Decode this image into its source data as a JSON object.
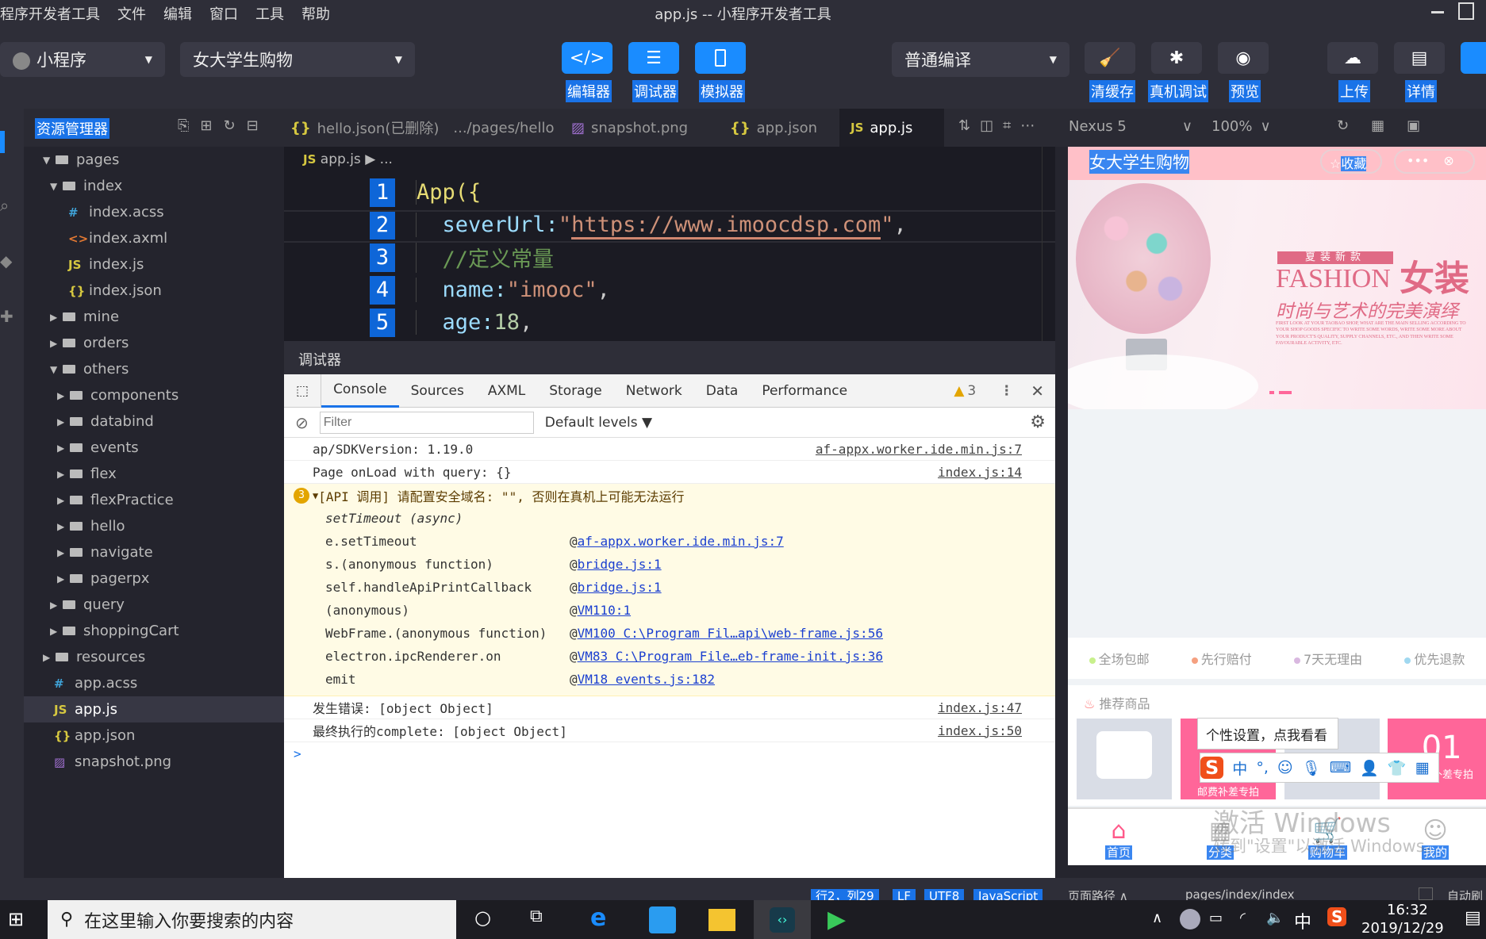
{
  "titlebar": {
    "menu": [
      "程序开发者工具",
      "文件",
      "编辑",
      "窗口",
      "工具",
      "帮助"
    ],
    "title": "app.js -- 小程序开发者工具"
  },
  "toolbar": {
    "project_type": "小程序",
    "project_name": "女大学生购物",
    "editor": "编辑器",
    "debugger": "调试器",
    "simulator": "模拟器",
    "compile_mode": "普通编译",
    "clear_cache": "清缓存",
    "device_debug": "真机调试",
    "preview": "预览",
    "upload": "上传",
    "details": "详情"
  },
  "sidebar": {
    "title": "资源管理器",
    "items": [
      {
        "label": "pages",
        "depth": 0,
        "type": "folder",
        "open": true
      },
      {
        "label": "index",
        "depth": 1,
        "type": "folder",
        "open": true
      },
      {
        "label": "index.acss",
        "depth": 2,
        "type": "css"
      },
      {
        "label": "index.axml",
        "depth": 2,
        "type": "xml"
      },
      {
        "label": "index.js",
        "depth": 2,
        "type": "js"
      },
      {
        "label": "index.json",
        "depth": 2,
        "type": "json"
      },
      {
        "label": "mine",
        "depth": 1,
        "type": "folder"
      },
      {
        "label": "orders",
        "depth": 1,
        "type": "folder"
      },
      {
        "label": "others",
        "depth": 1,
        "type": "folder",
        "open": true
      },
      {
        "label": "components",
        "depth": 2,
        "type": "folder"
      },
      {
        "label": "databind",
        "depth": 2,
        "type": "folder"
      },
      {
        "label": "events",
        "depth": 2,
        "type": "folder"
      },
      {
        "label": "flex",
        "depth": 2,
        "type": "folder"
      },
      {
        "label": "flexPractice",
        "depth": 2,
        "type": "folder"
      },
      {
        "label": "hello",
        "depth": 2,
        "type": "folder"
      },
      {
        "label": "navigate",
        "depth": 2,
        "type": "folder"
      },
      {
        "label": "pagerpx",
        "depth": 2,
        "type": "folder"
      },
      {
        "label": "query",
        "depth": 1,
        "type": "folder"
      },
      {
        "label": "shoppingCart",
        "depth": 1,
        "type": "folder"
      },
      {
        "label": "resources",
        "depth": 0,
        "type": "folder"
      },
      {
        "label": "app.acss",
        "depth": 0,
        "type": "css"
      },
      {
        "label": "app.js",
        "depth": 0,
        "type": "js",
        "active": true
      },
      {
        "label": "app.json",
        "depth": 0,
        "type": "json"
      },
      {
        "label": "snapshot.png",
        "depth": 0,
        "type": "img"
      }
    ]
  },
  "tabs": [
    {
      "label": "hello.json(已删除)",
      "path": ".../pages/hello",
      "icon": "{}"
    },
    {
      "label": "snapshot.png",
      "icon": "img"
    },
    {
      "label": "app.json",
      "icon": "{}"
    },
    {
      "label": "app.js",
      "icon": "JS",
      "active": true
    }
  ],
  "device": {
    "name": "Nexus 5",
    "zoom": "100%"
  },
  "editor": {
    "breadcrumb_file": "app.js",
    "breadcrumb_more": "...",
    "lines": [
      {
        "n": "1",
        "parts": [
          [
            "App({",
            "#e6db74"
          ]
        ]
      },
      {
        "n": "2",
        "parts": [
          [
            "  severUrl:",
            "#9cdcfe"
          ],
          [
            "\"",
            "#ce9178"
          ],
          [
            "https://www.imoocdsp.com",
            "#ce9178"
          ],
          [
            "\"",
            "#ce9178"
          ],
          [
            ",",
            "#ccc"
          ]
        ]
      },
      {
        "n": "3",
        "parts": [
          [
            "  //定义常量",
            "#6a9955"
          ]
        ]
      },
      {
        "n": "4",
        "parts": [
          [
            "  name:",
            "#9cdcfe"
          ],
          [
            "\"imooc\"",
            "#ce9178"
          ],
          [
            ",",
            "#ccc"
          ]
        ]
      },
      {
        "n": "5",
        "parts": [
          [
            "  age:",
            "#9cdcfe"
          ],
          [
            "18",
            "#b5cea8"
          ],
          [
            ",",
            "#ccc"
          ]
        ]
      }
    ]
  },
  "debugger": {
    "title": "调试器",
    "tabs": [
      "Console",
      "Sources",
      "AXML",
      "Storage",
      "Network",
      "Data",
      "Performance"
    ],
    "warn_count": "3",
    "filter_placeholder": "Filter",
    "levels": "Default levels",
    "logs": [
      {
        "text": "ap/SDKVersion: 1.19.0",
        "src": "af-appx.worker.ide.min.js:7"
      },
      {
        "text": "Page onLoad with query: {}",
        "src": "index.js:14"
      }
    ],
    "warning": {
      "count": "3",
      "text": "[API 调用] 请配置安全域名: \"\",  否则在真机上可能无法运行",
      "async": "setTimeout (async)",
      "stack": [
        {
          "fn": "e.setTimeout",
          "src": "af-appx.worker.ide.min.js:7"
        },
        {
          "fn": "s.(anonymous function)",
          "src": "bridge.js:1"
        },
        {
          "fn": "self.handleApiPrintCallback",
          "src": "bridge.js:1"
        },
        {
          "fn": "(anonymous)",
          "src": "VM110:1"
        },
        {
          "fn": "WebFrame.(anonymous function)",
          "src": "VM100 C:\\Program Fil…api\\web-frame.js:56"
        },
        {
          "fn": "electron.ipcRenderer.on",
          "src": "VM83 C:\\Program File…eb-frame-init.js:36"
        },
        {
          "fn": "emit",
          "src": "VM18 events.js:182"
        }
      ]
    },
    "logs2": [
      {
        "text": "发生错误: [object Object]",
        "src": "index.js:47"
      },
      {
        "text": "最终执行的complete: [object Object]",
        "src": "index.js:50"
      }
    ],
    "prompt": ">"
  },
  "simulator": {
    "nav_title": "女大学生购物",
    "favorite": "收藏",
    "banner": {
      "tag": "夏装新款",
      "title_en": "FASHION",
      "title_cn": "女装",
      "slogan": "时尚与艺术的完美演绎",
      "body": "FIRST LOOK AT YOUR TAOBAO SHOP, WHAT ARE THE MAIN SELLING ACCORDING TO YOUR SHOP GOODS SPECIFIC TO WRITE SOME WORDS, WRITE SOME MORE ABOUT YOUR PRODUCT'S QUALITY, SUPPLY CHANNELS, ETC., AND THEN WRITE SOME FAVOURABLE ACTIVITY, ETC."
    },
    "features": [
      {
        "label": "全场包邮",
        "color": "#c8f08c"
      },
      {
        "label": "先行赔付",
        "color": "#f5a080"
      },
      {
        "label": "7天无理由",
        "color": "#d9b8e0"
      },
      {
        "label": "优先退款",
        "color": "#a0d8f0"
      }
    ],
    "recommend_title": "推荐商品",
    "promo_label": "邮费补差专拍",
    "promo_price": ".01",
    "ime_tooltip": "个性设置，点我看看",
    "tabbar": [
      "首页",
      "分类",
      "购物车",
      "我的"
    ],
    "watermark1": "激活 Windows",
    "watermark2": "转到\"设置\"以激活 Windows。"
  },
  "statusbar": {
    "pos": "行2，列29",
    "eol": "LF",
    "enc": "UTF8",
    "lang": "JavaScript",
    "page_path_label": "页面路径",
    "page_path": "pages/index/index",
    "auto": "自动刷"
  },
  "taskbar": {
    "search_placeholder": "在这里输入你要搜索的内容",
    "time": "16:32",
    "date": "2019/12/29",
    "ime": "中"
  }
}
